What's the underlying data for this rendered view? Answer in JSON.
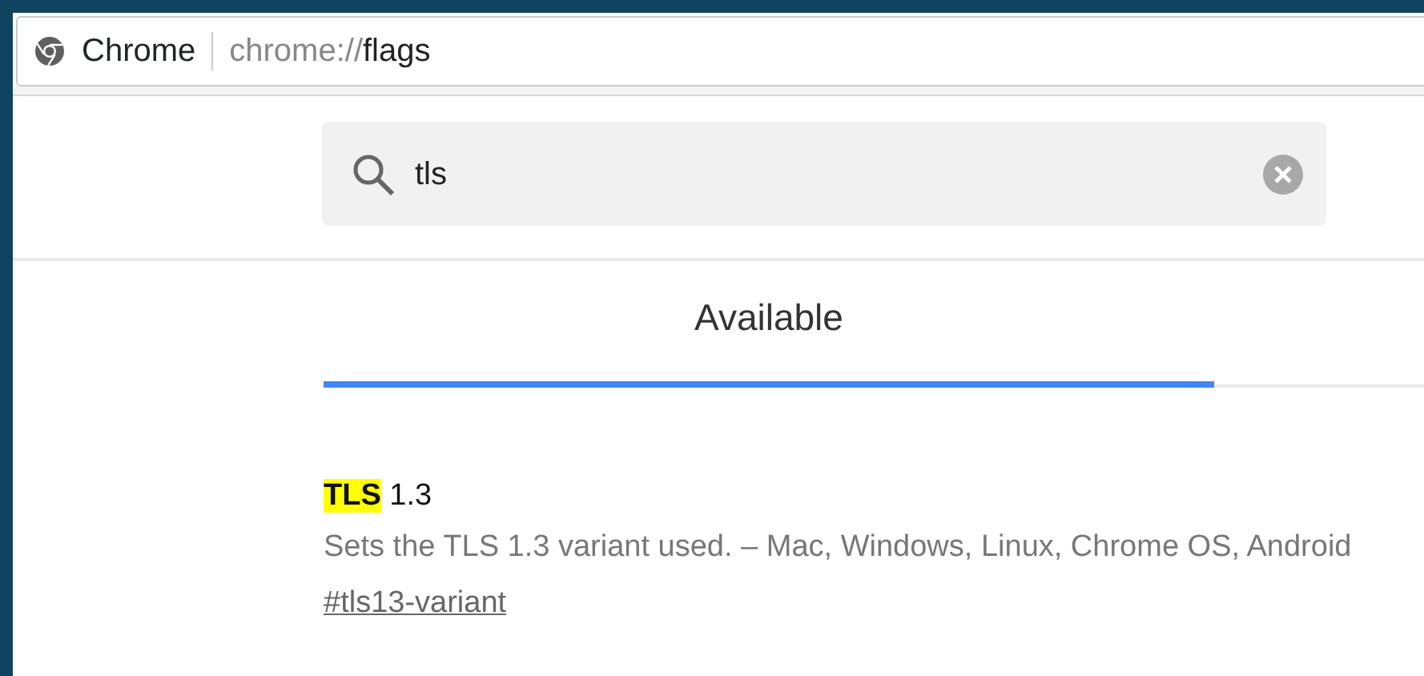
{
  "omnibox": {
    "site_label": "Chrome",
    "url_scheme": "chrome://",
    "url_path": "flags"
  },
  "search": {
    "value": "tls"
  },
  "tabs": [
    {
      "label": "Available",
      "selected": true
    }
  ],
  "experiments": [
    {
      "title_parts": [
        {
          "text": "TLS",
          "highlighted": true
        },
        {
          "text": "1.3",
          "highlighted": false
        }
      ],
      "description": "Sets the TLS 1.3 variant used. – Mac, Windows, Linux, Chrome OS, Android",
      "link": "#tls13-variant"
    }
  ]
}
